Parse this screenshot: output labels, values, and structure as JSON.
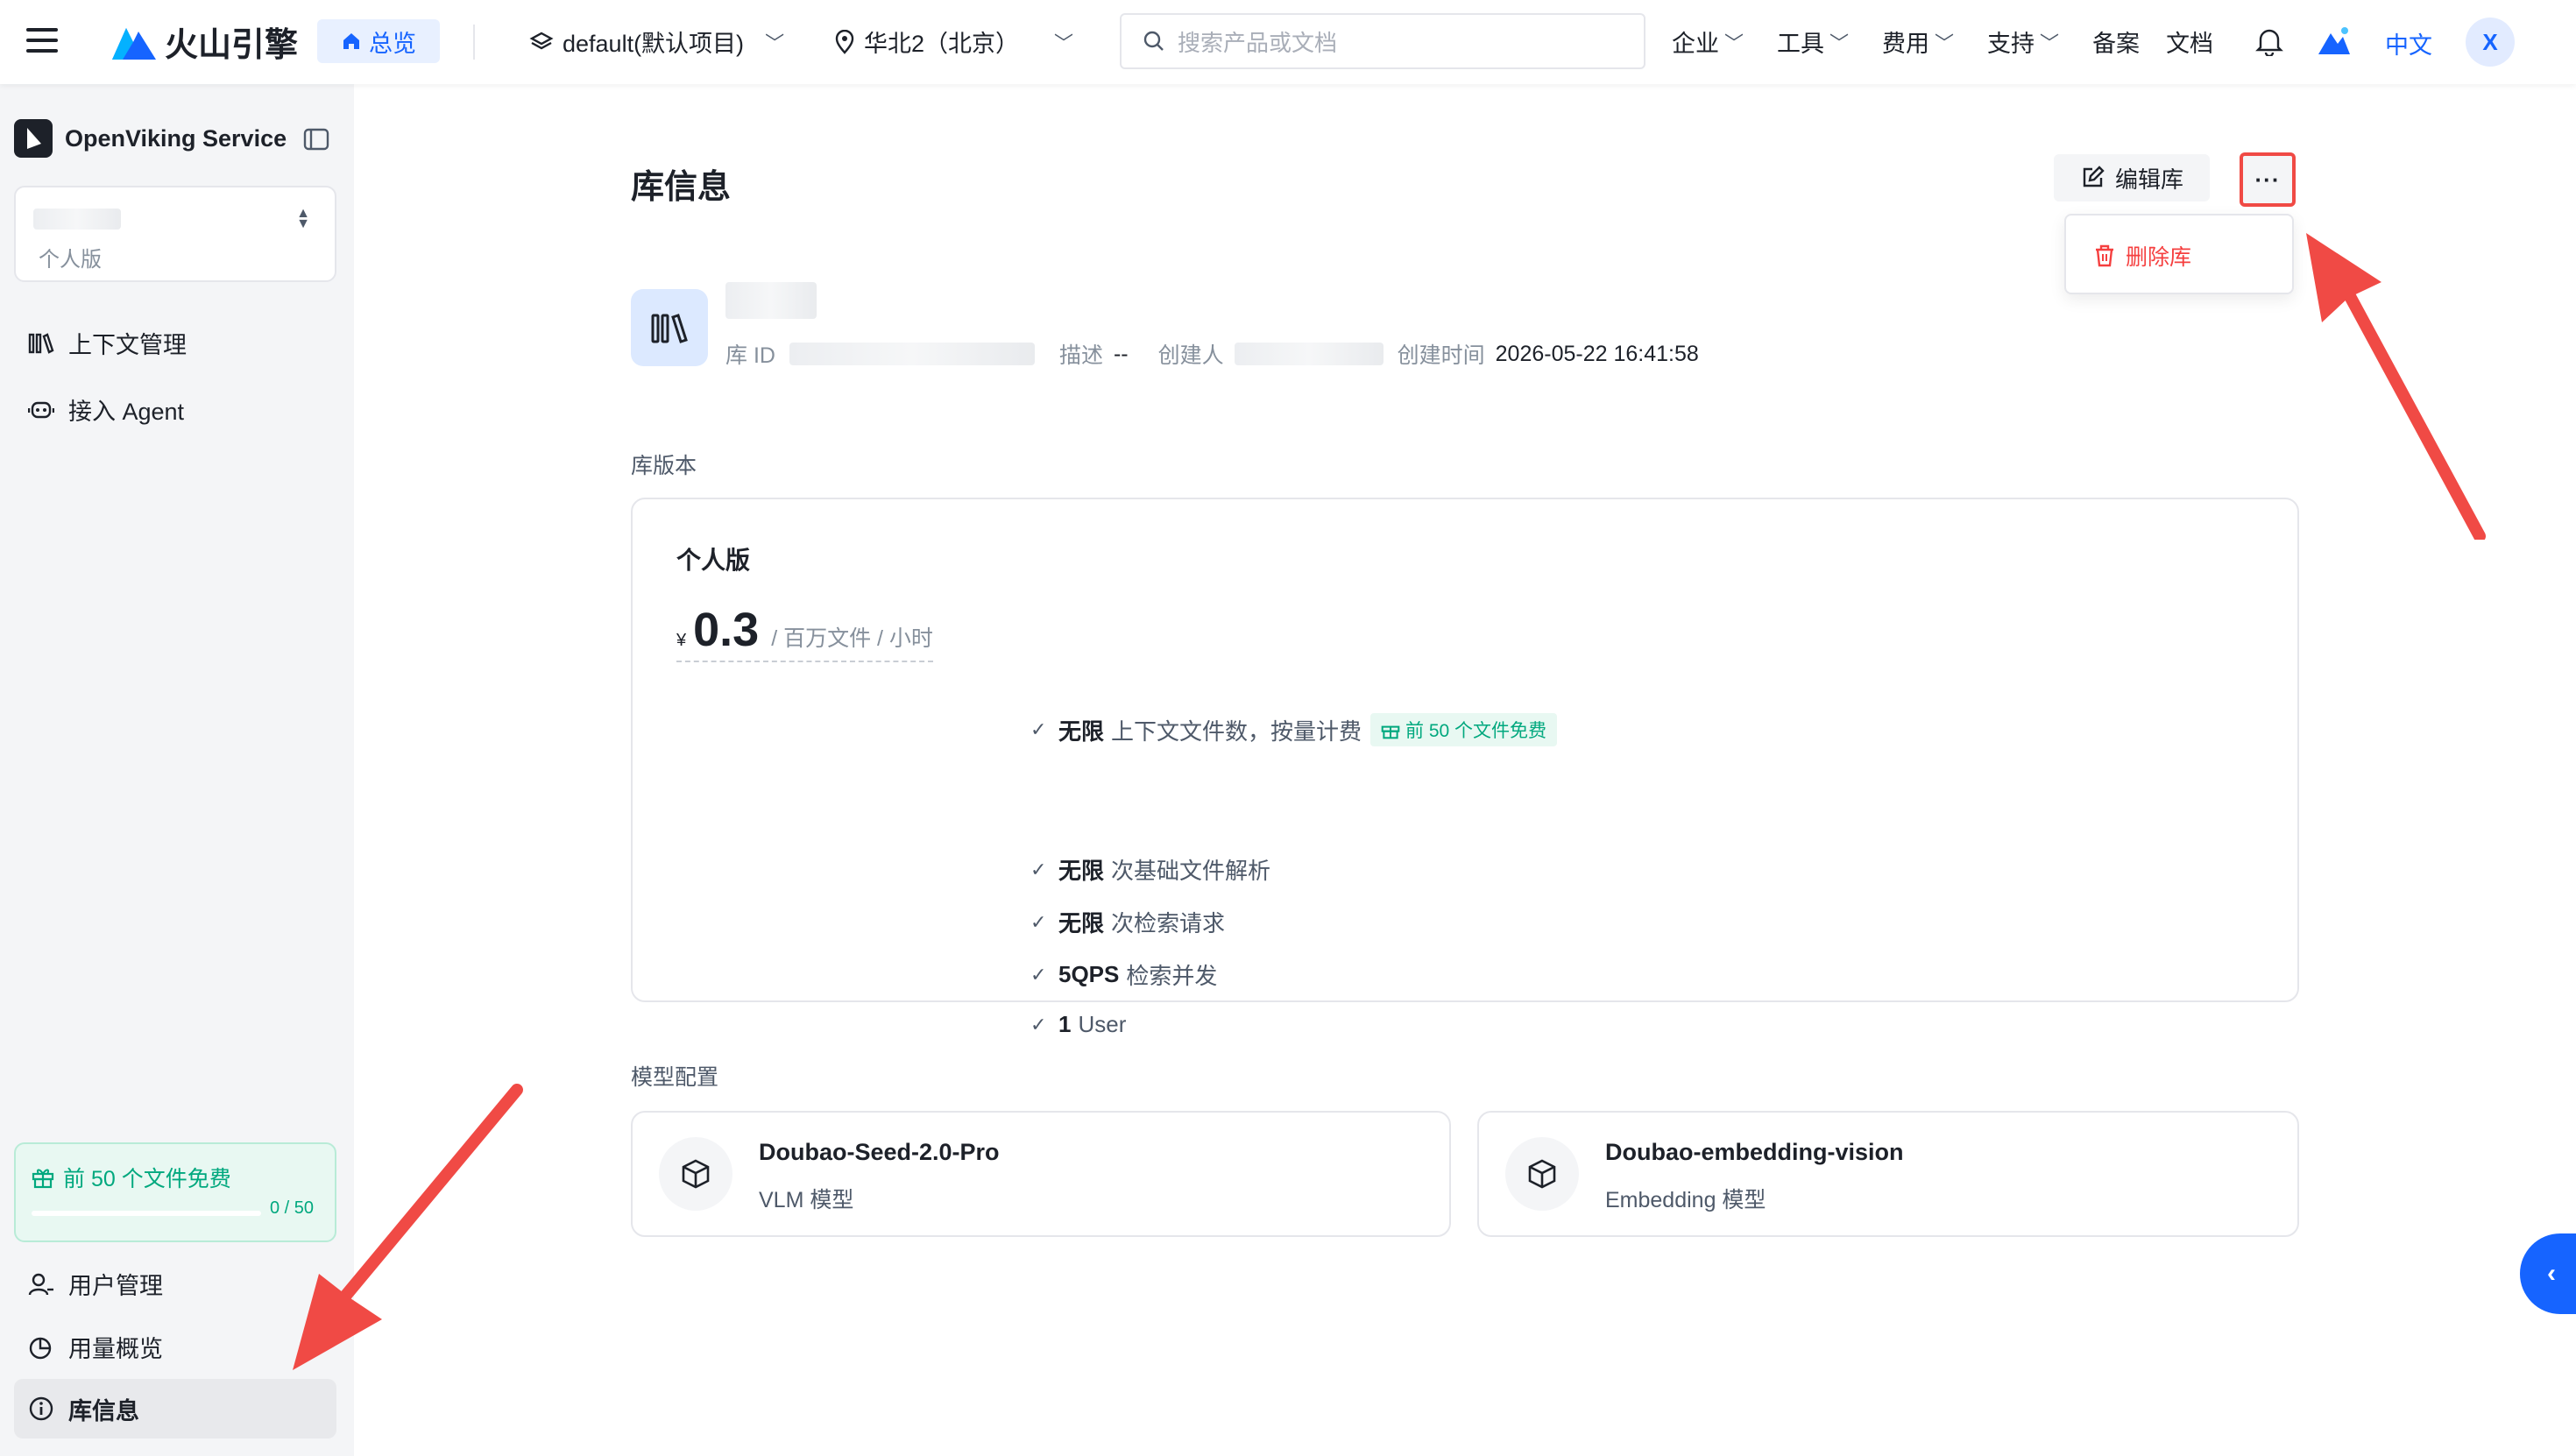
{
  "header": {
    "brand": "火山引擎",
    "home_label": "总览",
    "project_label": "default(默认项目)",
    "region_label": "华北2（北京）",
    "search_placeholder": "搜索产品或文档",
    "menu": [
      {
        "label": "企业",
        "has_dropdown": true
      },
      {
        "label": "工具",
        "has_dropdown": true
      },
      {
        "label": "费用",
        "has_dropdown": true
      },
      {
        "label": "支持",
        "has_dropdown": true
      },
      {
        "label": "备案",
        "has_dropdown": false
      },
      {
        "label": "文档",
        "has_dropdown": false
      }
    ],
    "language": "中文",
    "avatar_initial": "X"
  },
  "sidebar": {
    "service_name": "OpenViking Service",
    "library_edition": "个人版",
    "items": [
      {
        "label": "上下文管理",
        "icon": "library-icon"
      },
      {
        "label": "接入 Agent",
        "icon": "agent-icon"
      }
    ],
    "promo": {
      "label": "前 50 个文件免费",
      "progress_text": "0 / 50",
      "progress": 0
    },
    "bottom_items": [
      {
        "label": "用户管理",
        "icon": "user-icon",
        "active": false
      },
      {
        "label": "用量概览",
        "icon": "pie-chart-icon",
        "active": false
      },
      {
        "label": "库信息",
        "icon": "info-icon",
        "active": true
      }
    ]
  },
  "main": {
    "page_title": "库信息",
    "edit_label": "编辑库",
    "more_label": "···",
    "dropdown": {
      "delete_label": "删除库"
    },
    "library": {
      "id_label": "库 ID",
      "desc_label": "描述",
      "desc_value": "--",
      "creator_label": "创建人",
      "created_label": "创建时间",
      "created_value": "2026-05-22 16:41:58"
    },
    "version_section": "库版本",
    "plan": {
      "name": "个人版",
      "currency": "¥",
      "price": "0.3",
      "unit": "/ 百万文件 / 小时",
      "features": [
        {
          "bold": "无限",
          "text": "上下文文件数，按量计费",
          "badge": "前 50 个文件免费"
        },
        {
          "bold": "无限",
          "text": "次基础文件解析"
        },
        {
          "bold": "无限",
          "text": "次检索请求"
        },
        {
          "bold": "5QPS",
          "text": "检索并发"
        },
        {
          "bold": "1",
          "text": "User"
        }
      ]
    },
    "model_section": "模型配置",
    "models": [
      {
        "name": "Doubao-Seed-2.0-Pro",
        "type": "VLM 模型"
      },
      {
        "name": "Doubao-embedding-vision",
        "type": "Embedding 模型"
      }
    ]
  },
  "colors": {
    "accent": "#1664ff",
    "danger": "#f53f3f",
    "annotation": "#f04a45",
    "promo": "#00a87e"
  }
}
